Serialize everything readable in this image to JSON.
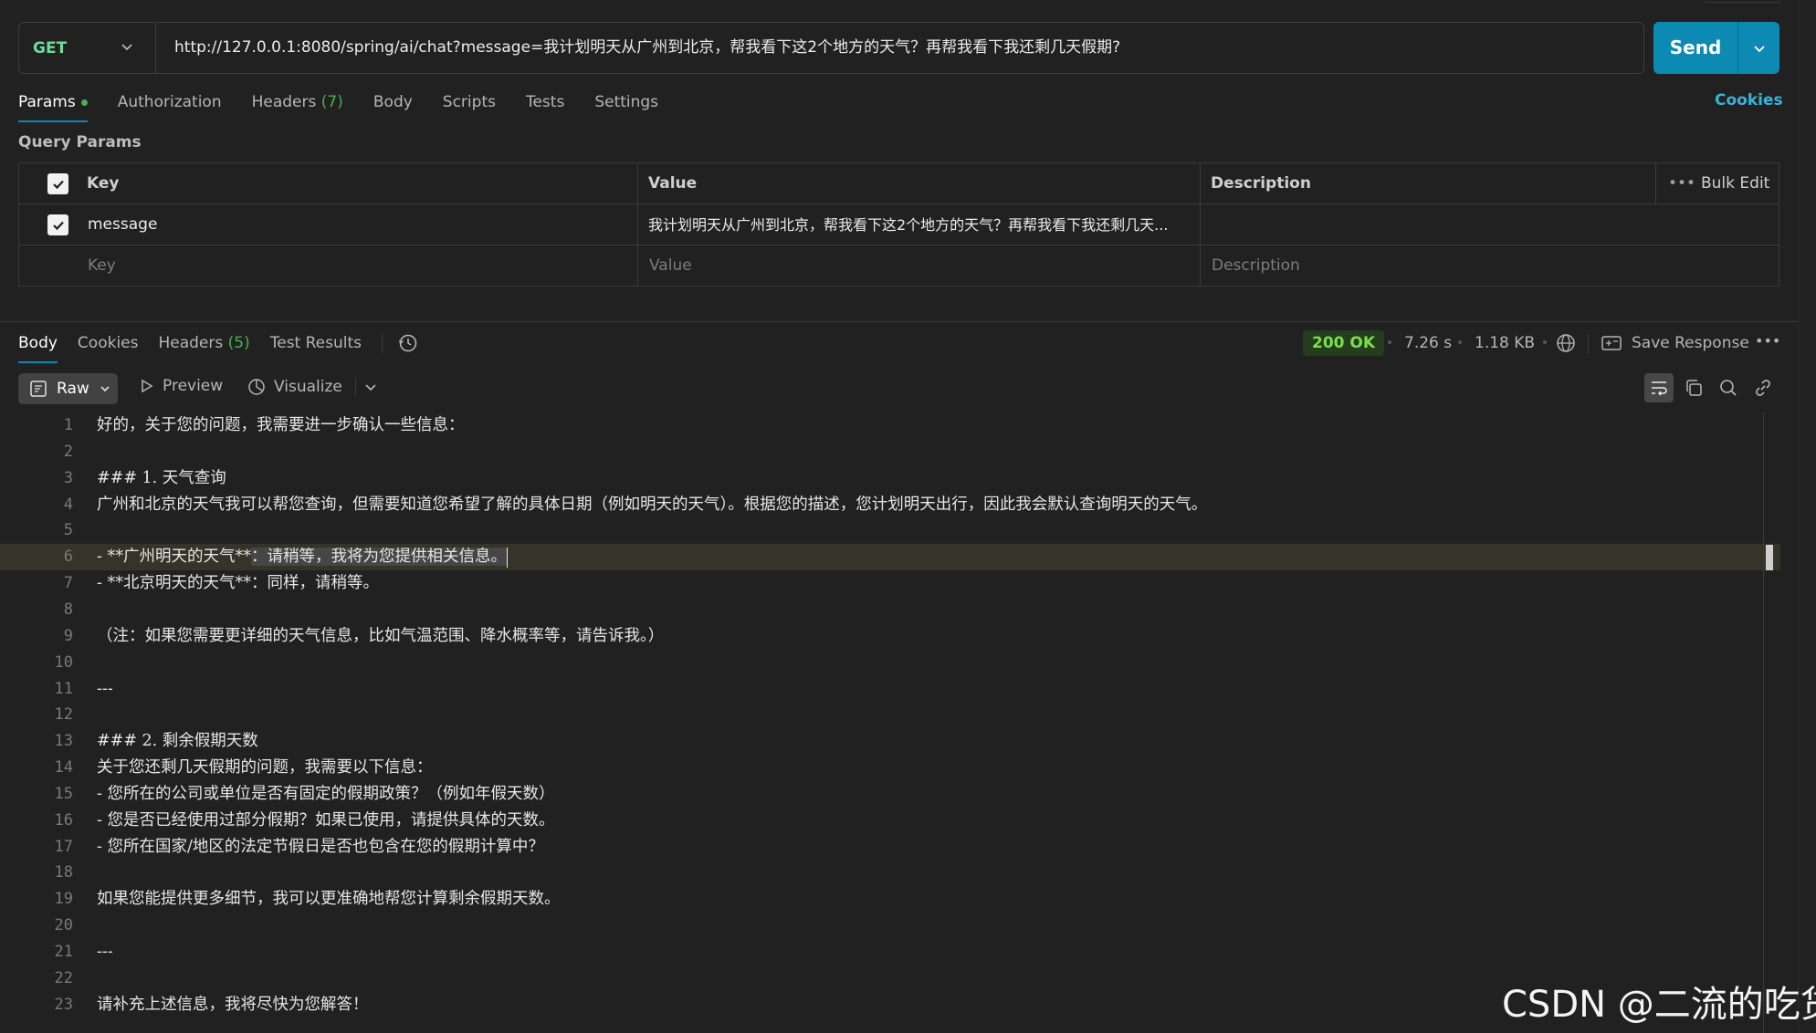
{
  "request": {
    "method": "GET",
    "url": "http://127.0.0.1:8080/spring/ai/chat?message=我计划明天从广州到北京，帮我看下这2个地方的天气？再帮我看下我还剩几天假期?",
    "send_label": "Send"
  },
  "request_tabs": [
    {
      "label": "Params",
      "active": true,
      "dot": true
    },
    {
      "label": "Authorization"
    },
    {
      "label": "Headers",
      "count": "(7)"
    },
    {
      "label": "Body"
    },
    {
      "label": "Scripts"
    },
    {
      "label": "Tests"
    },
    {
      "label": "Settings"
    }
  ],
  "cookies_label": "Cookies",
  "query_params": {
    "title": "Query Params",
    "headers": {
      "key": "Key",
      "value": "Value",
      "description": "Description",
      "bulk_edit": "Bulk Edit"
    },
    "rows": [
      {
        "checked": true,
        "key": "message",
        "value": "我计划明天从广州到北京，帮我看下这2个地方的天气？再帮我看下我还剩几天..."
      }
    ],
    "placeholders": {
      "key": "Key",
      "value": "Value",
      "description": "Description"
    }
  },
  "response": {
    "tabs": [
      {
        "label": "Body",
        "active": true
      },
      {
        "label": "Cookies"
      },
      {
        "label": "Headers",
        "count": "(5)"
      },
      {
        "label": "Test Results"
      }
    ],
    "status": "200 OK",
    "time": "7.26 s",
    "size": "1.18 KB",
    "save_response": "Save Response",
    "view_modes": {
      "raw": "Raw",
      "preview": "Preview",
      "visualize": "Visualize"
    },
    "lines": [
      "好的，关于您的问题，我需要进一步确认一些信息：",
      "",
      "### 1. 天气查询",
      "广州和北京的天气我可以帮您查询，但需要知道您希望了解的具体日期（例如明天的天气）。根据您的描述，您计划明天出行，因此我会默认查询明天的天气。",
      "",
      "- **广州明天的天气**：请稍等，我将为您提供相关信息。",
      "- **北京明天的天气**：同样，请稍等。",
      "",
      "（注：如果您需要更详细的天气信息，比如气温范围、降水概率等，请告诉我。）",
      "",
      "---",
      "",
      "### 2. 剩余假期天数",
      "关于您还剩几天假期的问题，我需要以下信息：",
      "- 您所在的公司或单位是否有固定的假期政策？（例如年假天数）",
      "- 您是否已经使用过部分假期？如果已使用，请提供具体的天数。",
      "- 您所在国家/地区的法定节假日是否也包含在您的假期计算中？",
      "",
      "如果您能提供更多细节，我可以更准确地帮您计算剩余假期天数。",
      "",
      "---",
      "",
      "请补充上述信息，我将尽快为您解答！"
    ],
    "highlight_line": 6,
    "selection": {
      "before": "- **广州明天的天气**",
      "selected": "：请稍等，我将为您提供相关信息。"
    }
  },
  "watermark": "CSDN @二流的吃货"
}
